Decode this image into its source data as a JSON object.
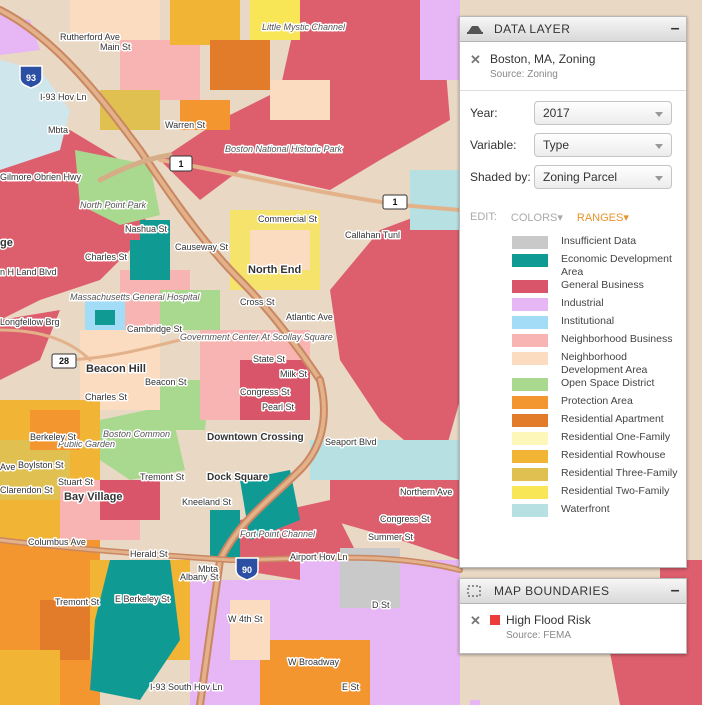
{
  "map": {
    "labels": {
      "little_mystic": "Little Mystic Channel",
      "boston_historic": "Boston National Historic Park",
      "rutherford": "Rutherford Ave",
      "main_st": "Main St",
      "i93_hwy": "I-93 Hov Ln",
      "mbta1": "Mbta",
      "warren": "Warren St",
      "gilmore": "Gilmore Obrien Hwy",
      "north_point": "North Point Park",
      "nashua": "Nashua St",
      "charles": "Charles St",
      "causeway": "Causeway St",
      "commercial": "Commercial St",
      "callahan": "Callahan Tunl",
      "north_end": "North End",
      "mass_general": "Massachusetts General Hospital",
      "cambridge_st": "Cambridge St",
      "longfellow": "Longfellow Brg",
      "cross_st": "Cross St",
      "atlantic": "Atlantic Ave",
      "gov_center": "Government Center At Scollay Square",
      "beacon_hill": "Beacon Hill",
      "beacon_st": "Beacon St",
      "charles_st2": "Charles St",
      "state_st": "State St",
      "milk_st": "Milk St",
      "congress": "Congress St",
      "pearl": "Pearl St",
      "public_garden": "Public Garden",
      "boston_common": "Boston Common",
      "downtown": "Downtown Crossing",
      "seaport": "Seaport Blvd",
      "berkeley": "Berkeley St",
      "boylston": "Boylston St",
      "clarendon": "Clarendon St",
      "stuart": "Stuart St",
      "bay_village": "Bay Village",
      "tremont": "Tremont St",
      "dock_square": "Dock Square",
      "kneeland": "Kneeland St",
      "fort_point": "Fort Point Channel",
      "northern": "Northern Ave",
      "congress2": "Congress St",
      "summer": "Summer St",
      "columbus": "Columbus Ave",
      "herald": "Herald St",
      "mbta2": "Mbta",
      "airport": "Airport Hov Ln",
      "tremont2": "Tremont St",
      "e_berkeley": "E Berkeley St",
      "albany": "Albany St",
      "w4th": "W 4th St",
      "d_st": "D St",
      "w_broadway": "W Broadway",
      "e_st": "E St",
      "south_hov": "I-93 South Hov Ln",
      "ave": "Ave",
      "ge": "ge",
      "blvd": "n H Land Blvd"
    },
    "shields": {
      "i93": "93",
      "us1": "1",
      "us1b": "1",
      "r28": "28",
      "i90": "90"
    }
  },
  "data_layer": {
    "header": "DATA LAYER",
    "minimize": "–",
    "layer_name": "Boston, MA, Zoning",
    "source": "Source: Zoning",
    "year_label": "Year:",
    "year_value": "2017",
    "variable_label": "Variable:",
    "variable_value": "Type",
    "shaded_label": "Shaded by:",
    "shaded_value": "Zoning Parcel",
    "edit_label": "EDIT:",
    "colors_label": "COLORS",
    "ranges_label": "RANGES",
    "legend": [
      {
        "label": "Insufficient Data",
        "color": "#c9c9c9"
      },
      {
        "label": "Economic Development Area",
        "color": "#0f9b94"
      },
      {
        "label": "General Business",
        "color": "#d9566a"
      },
      {
        "label": "Industrial",
        "color": "#e6b6f5"
      },
      {
        "label": "Institutional",
        "color": "#a3dcf7"
      },
      {
        "label": "Neighborhood Business",
        "color": "#f8b4b2"
      },
      {
        "label": "Neighborhood Development Area",
        "color": "#fcdcc0"
      },
      {
        "label": "Open Space District",
        "color": "#a8d98f"
      },
      {
        "label": "Protection Area",
        "color": "#f4962f"
      },
      {
        "label": "Residential Apartment",
        "color": "#e37c2a"
      },
      {
        "label": "Residential One-Family",
        "color": "#fdf7ba"
      },
      {
        "label": "Residential Rowhouse",
        "color": "#f2b435"
      },
      {
        "label": "Residential Three-Family",
        "color": "#e0c050"
      },
      {
        "label": "Residential Two-Family",
        "color": "#f8e656"
      },
      {
        "label": "Waterfront",
        "color": "#b7e0e2"
      }
    ]
  },
  "boundaries": {
    "header": "MAP BOUNDARIES",
    "minimize": "–",
    "layer_name": "High Flood Risk",
    "source": "Source: FEMA",
    "flag_color": "#ec3b3b"
  }
}
